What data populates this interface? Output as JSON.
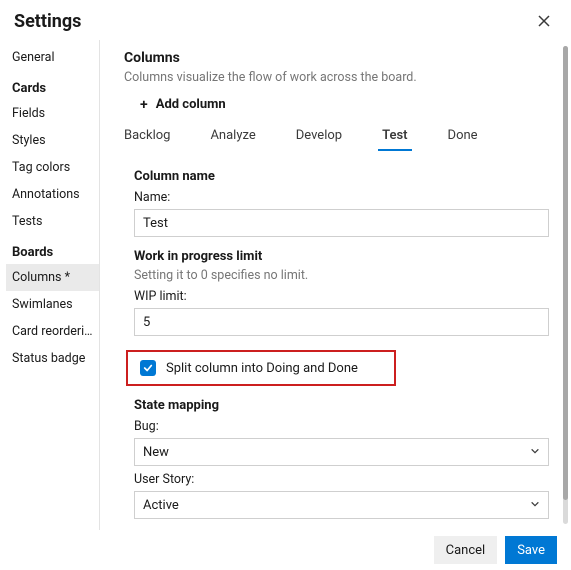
{
  "header": {
    "title": "Settings"
  },
  "sidebar": {
    "groups": [
      {
        "title": "",
        "items": [
          {
            "label": "General",
            "selected": false
          }
        ]
      },
      {
        "title": "Cards",
        "items": [
          {
            "label": "Fields",
            "selected": false
          },
          {
            "label": "Styles",
            "selected": false
          },
          {
            "label": "Tag colors",
            "selected": false
          },
          {
            "label": "Annotations",
            "selected": false
          },
          {
            "label": "Tests",
            "selected": false
          }
        ]
      },
      {
        "title": "Boards",
        "items": [
          {
            "label": "Columns *",
            "selected": true
          },
          {
            "label": "Swimlanes",
            "selected": false
          },
          {
            "label": "Card reorderi…",
            "selected": false
          },
          {
            "label": "Status badge",
            "selected": false
          }
        ]
      }
    ]
  },
  "columns": {
    "heading": "Columns",
    "subtext": "Columns visualize the flow of work across the board.",
    "add_label": "Add column",
    "tabs": [
      {
        "label": "Backlog",
        "active": false
      },
      {
        "label": "Analyze",
        "active": false
      },
      {
        "label": "Develop",
        "active": false
      },
      {
        "label": "Test",
        "active": true
      },
      {
        "label": "Done",
        "active": false
      }
    ],
    "column_name_heading": "Column name",
    "name_label": "Name:",
    "name_value": "Test",
    "wip_heading": "Work in progress limit",
    "wip_subtext": "Setting it to 0 specifies no limit.",
    "wip_label": "WIP limit:",
    "wip_value": "5",
    "split_checked": true,
    "split_label": "Split column into Doing and Done",
    "state_mapping_heading": "State mapping",
    "bug_label": "Bug:",
    "bug_value": "New",
    "user_story_label": "User Story:",
    "user_story_value": "Active"
  },
  "footer": {
    "cancel": "Cancel",
    "save": "Save"
  }
}
